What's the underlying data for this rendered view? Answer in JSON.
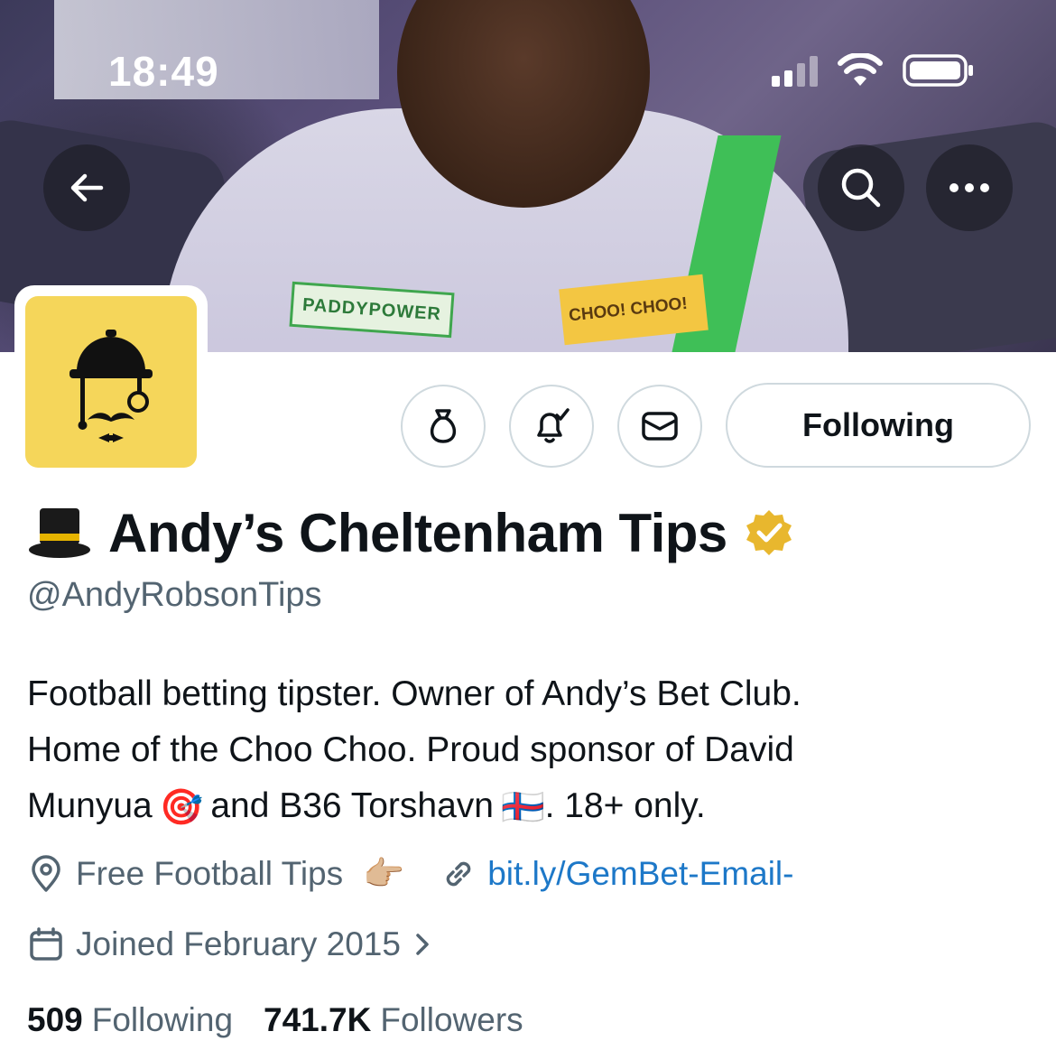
{
  "status_bar": {
    "time": "18:49"
  },
  "banner": {
    "patch_left_text": "PADDYPOWER",
    "patch_right_text": "CHOO! CHOO!"
  },
  "nav": {
    "back_icon": "arrow-left-icon",
    "search_icon": "search-icon",
    "more_icon": "more-horizontal-icon"
  },
  "actions": {
    "following_label": "Following"
  },
  "profile": {
    "name_emoji": "🎩",
    "display_name": "Andy’s Cheltenham Tips",
    "handle": "@AndyRobsonTips",
    "bio_line1": "Football betting tipster. Owner of Andy’s Bet Club.",
    "bio_line2": "Home of the Choo Choo. Proud sponsor of David",
    "bio_line3_a": "Munyua",
    "bio_emoji_dart": "🎯",
    "bio_line3_b": "and B36 Torshavn",
    "bio_emoji_flag": "🇫🇴",
    "bio_line3_c": ". 18+ only.",
    "location": "Free Football Tips",
    "location_emoji": "👉🏼",
    "website": "bit.ly/GemBet-Email-",
    "joined": "Joined February 2015"
  },
  "stats": {
    "following_count": "509",
    "following_label": "Following",
    "followers_count": "741.7K",
    "followers_label": "Followers"
  },
  "colors": {
    "link": "#1d78c8",
    "secondary_text": "#536471",
    "verified_badge": "#e8b72e",
    "avatar_bg": "#f5d65a"
  }
}
